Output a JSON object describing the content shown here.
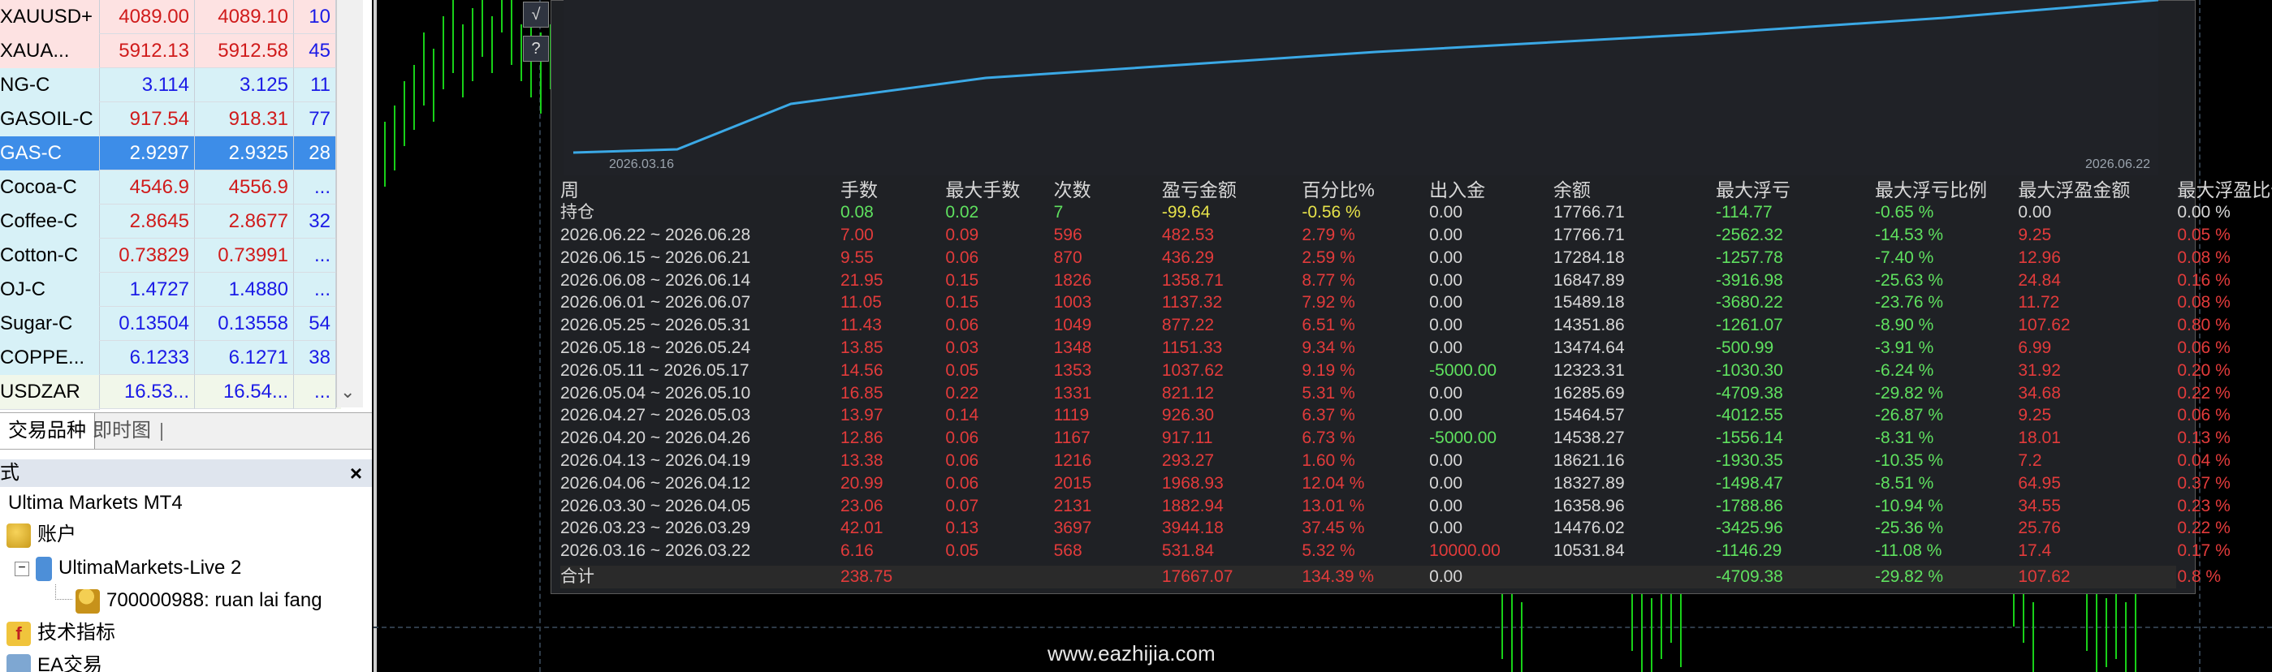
{
  "market_watch": {
    "rows": [
      {
        "symbol": "XAUUSD+",
        "bid": "4089.00",
        "ask": "4089.10",
        "spread": "10",
        "bg": "pink",
        "price_color": "red"
      },
      {
        "symbol": "XAUA...",
        "bid": "5912.13",
        "ask": "5912.58",
        "spread": "45",
        "bg": "pink",
        "price_color": "red"
      },
      {
        "symbol": "NG-C",
        "bid": "3.114",
        "ask": "3.125",
        "spread": "11",
        "bg": "cyan",
        "price_color": "blue"
      },
      {
        "symbol": "GASOIL-C",
        "bid": "917.54",
        "ask": "918.31",
        "spread": "77",
        "bg": "cyan",
        "price_color": "red"
      },
      {
        "symbol": "GAS-C",
        "bid": "2.9297",
        "ask": "2.9325",
        "spread": "28",
        "bg": "selected",
        "price_color": "white"
      },
      {
        "symbol": "Cocoa-C",
        "bid": "4546.9",
        "ask": "4556.9",
        "spread": "...",
        "bg": "cyan",
        "price_color": "red"
      },
      {
        "symbol": "Coffee-C",
        "bid": "2.8645",
        "ask": "2.8677",
        "spread": "32",
        "bg": "cyan",
        "price_color": "red"
      },
      {
        "symbol": "Cotton-C",
        "bid": "0.73829",
        "ask": "0.73991",
        "spread": "...",
        "bg": "cyan",
        "price_color": "red"
      },
      {
        "symbol": "OJ-C",
        "bid": "1.4727",
        "ask": "1.4880",
        "spread": "...",
        "bg": "cyan",
        "price_color": "blue"
      },
      {
        "symbol": "Sugar-C",
        "bid": "0.13504",
        "ask": "0.13558",
        "spread": "54",
        "bg": "cyan",
        "price_color": "blue"
      },
      {
        "symbol": "COPPE...",
        "bid": "6.1233",
        "ask": "6.1271",
        "spread": "38",
        "bg": "cyan",
        "price_color": "blue"
      },
      {
        "symbol": "USDZAR",
        "bid": "16.53...",
        "ask": "16.54...",
        "spread": "...",
        "bg": "light",
        "price_color": "blue"
      }
    ],
    "tabs": {
      "symbols": "交易品种",
      "tick_chart": "即时图"
    }
  },
  "navigator": {
    "title": "式",
    "close": "×",
    "root": "Ultima Markets MT4",
    "accounts": "账户",
    "server": "UltimaMarkets-Live 2",
    "account": "700000988: ruan lai fang",
    "indicators": "技术指标",
    "ea": "EA交易"
  },
  "chart_buttons": {
    "sqrt": "√",
    "help": "?"
  },
  "equity_chart": {
    "x_start": "2026.03.16",
    "x_end": "2026.06.22",
    "line_color": "#3ba9e6"
  },
  "stats": {
    "headers": [
      "周",
      "手数",
      "最大手数",
      "次数",
      "盈亏金额",
      "百分比%",
      "出入金",
      "余额",
      "最大浮亏",
      "最大浮亏比例",
      "最大浮盈金额",
      "最大浮盈比例"
    ],
    "holding": [
      "持仓",
      "0.08",
      "0.02",
      "7",
      "-99.64",
      "-0.56 %",
      "0.00",
      "17766.71",
      "-114.77",
      "-0.65 %",
      "0.00",
      "0.00 %"
    ],
    "rows": [
      [
        "2026.06.22 ~ 2026.06.28",
        "7.00",
        "0.09",
        "596",
        "482.53",
        "2.79 %",
        "0.00",
        "17766.71",
        "-2562.32",
        "-14.53 %",
        "9.25",
        "0.05 %"
      ],
      [
        "2026.06.15 ~ 2026.06.21",
        "9.55",
        "0.06",
        "870",
        "436.29",
        "2.59 %",
        "0.00",
        "17284.18",
        "-1257.78",
        "-7.40 %",
        "12.96",
        "0.08 %"
      ],
      [
        "2026.06.08 ~ 2026.06.14",
        "21.95",
        "0.15",
        "1826",
        "1358.71",
        "8.77 %",
        "0.00",
        "16847.89",
        "-3916.98",
        "-25.63 %",
        "24.84",
        "0.16 %"
      ],
      [
        "2026.06.01 ~ 2026.06.07",
        "11.05",
        "0.15",
        "1003",
        "1137.32",
        "7.92 %",
        "0.00",
        "15489.18",
        "-3680.22",
        "-23.76 %",
        "11.72",
        "0.08 %"
      ],
      [
        "2026.05.25 ~ 2026.05.31",
        "11.43",
        "0.06",
        "1049",
        "877.22",
        "6.51 %",
        "0.00",
        "14351.86",
        "-1261.07",
        "-8.90 %",
        "107.62",
        "0.80 %"
      ],
      [
        "2026.05.18 ~ 2026.05.24",
        "13.85",
        "0.03",
        "1348",
        "1151.33",
        "9.34 %",
        "0.00",
        "13474.64",
        "-500.99",
        "-3.91 %",
        "6.99",
        "0.06 %"
      ],
      [
        "2026.05.11 ~ 2026.05.17",
        "14.56",
        "0.05",
        "1353",
        "1037.62",
        "9.19 %",
        "-5000.00",
        "12323.31",
        "-1030.30",
        "-6.24 %",
        "31.92",
        "0.20 %"
      ],
      [
        "2026.05.04 ~ 2026.05.10",
        "16.85",
        "0.22",
        "1331",
        "821.12",
        "5.31 %",
        "0.00",
        "16285.69",
        "-4709.38",
        "-29.82 %",
        "34.68",
        "0.22 %"
      ],
      [
        "2026.04.27 ~ 2026.05.03",
        "13.97",
        "0.14",
        "1119",
        "926.30",
        "6.37 %",
        "0.00",
        "15464.57",
        "-4012.55",
        "-26.87 %",
        "9.25",
        "0.06 %"
      ],
      [
        "2026.04.20 ~ 2026.04.26",
        "12.86",
        "0.06",
        "1167",
        "917.11",
        "6.73 %",
        "-5000.00",
        "14538.27",
        "-1556.14",
        "-8.31 %",
        "18.01",
        "0.13 %"
      ],
      [
        "2026.04.13 ~ 2026.04.19",
        "13.38",
        "0.06",
        "1216",
        "293.27",
        "1.60 %",
        "0.00",
        "18621.16",
        "-1930.35",
        "-10.35 %",
        "7.2",
        "0.04 %"
      ],
      [
        "2026.04.06 ~ 2026.04.12",
        "20.99",
        "0.06",
        "2015",
        "1968.93",
        "12.04 %",
        "0.00",
        "18327.89",
        "-1498.47",
        "-8.51 %",
        "64.95",
        "0.37 %"
      ],
      [
        "2026.03.30 ~ 2026.04.05",
        "23.06",
        "0.07",
        "2131",
        "1882.94",
        "13.01 %",
        "0.00",
        "16358.96",
        "-1788.86",
        "-10.94 %",
        "34.55",
        "0.23 %"
      ],
      [
        "2026.03.23 ~ 2026.03.29",
        "42.01",
        "0.13",
        "3697",
        "3944.18",
        "37.45 %",
        "0.00",
        "14476.02",
        "-3425.96",
        "-25.36 %",
        "25.76",
        "0.22 %"
      ],
      [
        "2026.03.16 ~ 2026.03.22",
        "6.16",
        "0.05",
        "568",
        "531.84",
        "5.32 %",
        "10000.00",
        "10531.84",
        "-1146.29",
        "-11.08 %",
        "17.4",
        "0.17 %"
      ]
    ],
    "total": [
      "合计",
      "238.75",
      "",
      "",
      "17667.07",
      "134.39 %",
      "0.00",
      "",
      "-4709.38",
      "-29.82 %",
      "107.62",
      "0.8 %"
    ]
  },
  "watermark": "www.eazhijia.com"
}
